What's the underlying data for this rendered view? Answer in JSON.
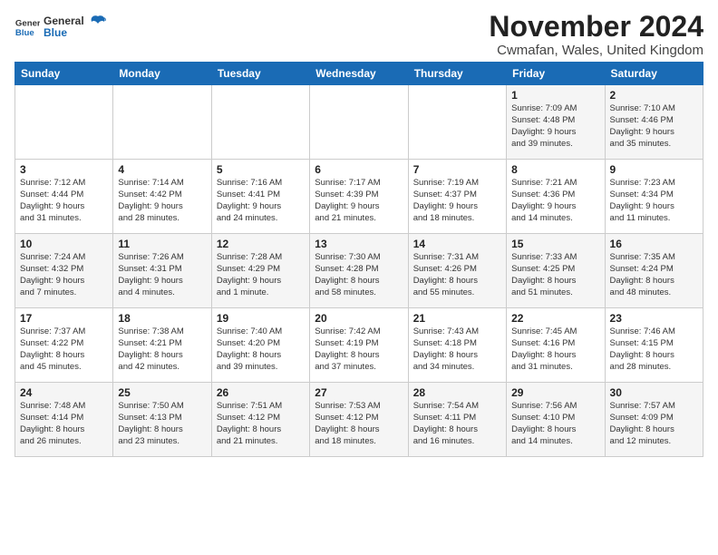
{
  "logo": {
    "line1": "General",
    "line2": "Blue"
  },
  "header": {
    "month": "November 2024",
    "location": "Cwmafan, Wales, United Kingdom"
  },
  "weekdays": [
    "Sunday",
    "Monday",
    "Tuesday",
    "Wednesday",
    "Thursday",
    "Friday",
    "Saturday"
  ],
  "weeks": [
    [
      {
        "day": "",
        "info": ""
      },
      {
        "day": "",
        "info": ""
      },
      {
        "day": "",
        "info": ""
      },
      {
        "day": "",
        "info": ""
      },
      {
        "day": "",
        "info": ""
      },
      {
        "day": "1",
        "info": "Sunrise: 7:09 AM\nSunset: 4:48 PM\nDaylight: 9 hours\nand 39 minutes."
      },
      {
        "day": "2",
        "info": "Sunrise: 7:10 AM\nSunset: 4:46 PM\nDaylight: 9 hours\nand 35 minutes."
      }
    ],
    [
      {
        "day": "3",
        "info": "Sunrise: 7:12 AM\nSunset: 4:44 PM\nDaylight: 9 hours\nand 31 minutes."
      },
      {
        "day": "4",
        "info": "Sunrise: 7:14 AM\nSunset: 4:42 PM\nDaylight: 9 hours\nand 28 minutes."
      },
      {
        "day": "5",
        "info": "Sunrise: 7:16 AM\nSunset: 4:41 PM\nDaylight: 9 hours\nand 24 minutes."
      },
      {
        "day": "6",
        "info": "Sunrise: 7:17 AM\nSunset: 4:39 PM\nDaylight: 9 hours\nand 21 minutes."
      },
      {
        "day": "7",
        "info": "Sunrise: 7:19 AM\nSunset: 4:37 PM\nDaylight: 9 hours\nand 18 minutes."
      },
      {
        "day": "8",
        "info": "Sunrise: 7:21 AM\nSunset: 4:36 PM\nDaylight: 9 hours\nand 14 minutes."
      },
      {
        "day": "9",
        "info": "Sunrise: 7:23 AM\nSunset: 4:34 PM\nDaylight: 9 hours\nand 11 minutes."
      }
    ],
    [
      {
        "day": "10",
        "info": "Sunrise: 7:24 AM\nSunset: 4:32 PM\nDaylight: 9 hours\nand 7 minutes."
      },
      {
        "day": "11",
        "info": "Sunrise: 7:26 AM\nSunset: 4:31 PM\nDaylight: 9 hours\nand 4 minutes."
      },
      {
        "day": "12",
        "info": "Sunrise: 7:28 AM\nSunset: 4:29 PM\nDaylight: 9 hours\nand 1 minute."
      },
      {
        "day": "13",
        "info": "Sunrise: 7:30 AM\nSunset: 4:28 PM\nDaylight: 8 hours\nand 58 minutes."
      },
      {
        "day": "14",
        "info": "Sunrise: 7:31 AM\nSunset: 4:26 PM\nDaylight: 8 hours\nand 55 minutes."
      },
      {
        "day": "15",
        "info": "Sunrise: 7:33 AM\nSunset: 4:25 PM\nDaylight: 8 hours\nand 51 minutes."
      },
      {
        "day": "16",
        "info": "Sunrise: 7:35 AM\nSunset: 4:24 PM\nDaylight: 8 hours\nand 48 minutes."
      }
    ],
    [
      {
        "day": "17",
        "info": "Sunrise: 7:37 AM\nSunset: 4:22 PM\nDaylight: 8 hours\nand 45 minutes."
      },
      {
        "day": "18",
        "info": "Sunrise: 7:38 AM\nSunset: 4:21 PM\nDaylight: 8 hours\nand 42 minutes."
      },
      {
        "day": "19",
        "info": "Sunrise: 7:40 AM\nSunset: 4:20 PM\nDaylight: 8 hours\nand 39 minutes."
      },
      {
        "day": "20",
        "info": "Sunrise: 7:42 AM\nSunset: 4:19 PM\nDaylight: 8 hours\nand 37 minutes."
      },
      {
        "day": "21",
        "info": "Sunrise: 7:43 AM\nSunset: 4:18 PM\nDaylight: 8 hours\nand 34 minutes."
      },
      {
        "day": "22",
        "info": "Sunrise: 7:45 AM\nSunset: 4:16 PM\nDaylight: 8 hours\nand 31 minutes."
      },
      {
        "day": "23",
        "info": "Sunrise: 7:46 AM\nSunset: 4:15 PM\nDaylight: 8 hours\nand 28 minutes."
      }
    ],
    [
      {
        "day": "24",
        "info": "Sunrise: 7:48 AM\nSunset: 4:14 PM\nDaylight: 8 hours\nand 26 minutes."
      },
      {
        "day": "25",
        "info": "Sunrise: 7:50 AM\nSunset: 4:13 PM\nDaylight: 8 hours\nand 23 minutes."
      },
      {
        "day": "26",
        "info": "Sunrise: 7:51 AM\nSunset: 4:12 PM\nDaylight: 8 hours\nand 21 minutes."
      },
      {
        "day": "27",
        "info": "Sunrise: 7:53 AM\nSunset: 4:12 PM\nDaylight: 8 hours\nand 18 minutes."
      },
      {
        "day": "28",
        "info": "Sunrise: 7:54 AM\nSunset: 4:11 PM\nDaylight: 8 hours\nand 16 minutes."
      },
      {
        "day": "29",
        "info": "Sunrise: 7:56 AM\nSunset: 4:10 PM\nDaylight: 8 hours\nand 14 minutes."
      },
      {
        "day": "30",
        "info": "Sunrise: 7:57 AM\nSunset: 4:09 PM\nDaylight: 8 hours\nand 12 minutes."
      }
    ]
  ]
}
